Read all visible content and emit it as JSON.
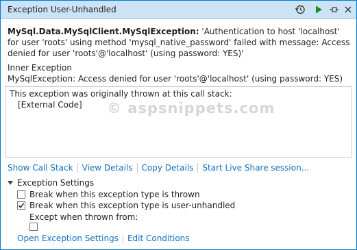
{
  "window": {
    "title": "Exception User-Unhandled"
  },
  "toolbar": {
    "history_icon": "history-icon",
    "continue_icon": "continue-play-icon",
    "pin_icon": "pin-icon",
    "close_icon": "close-icon"
  },
  "exception": {
    "type": "MySql.Data.MySqlClient.MySqlException:",
    "message": "'Authentication to host 'localhost' for user 'roots' using method 'mysql_native_password' failed with message: Access denied for user 'roots'@'localhost' (using password: YES)'",
    "inner_heading": "Inner Exception",
    "inner_message": "MySqlException: Access denied for user 'roots'@'localhost' (using password: YES)"
  },
  "call_stack": {
    "heading": "This exception was originally thrown at this call stack:",
    "lines": [
      "[External Code]"
    ],
    "watermark": "© aspsnippets.com"
  },
  "links": {
    "show_call_stack": "Show Call Stack",
    "view_details": "View Details",
    "copy_details": "Copy Details",
    "live_share": "Start Live Share session..."
  },
  "settings": {
    "heading": "Exception Settings",
    "break_thrown": {
      "label": "Break when this exception type is thrown",
      "checked": false
    },
    "break_unhandled": {
      "label": "Break when this exception type is user-unhandled",
      "checked": true
    },
    "except_label": "Except when thrown from:",
    "except_checked": false
  },
  "bottom_links": {
    "open_settings": "Open Exception Settings",
    "edit_conditions": "Edit Conditions"
  },
  "colors": {
    "accent": "#007acc",
    "titlebar": "#cce3f6",
    "link": "#0e70c0",
    "play_green": "#1e8a1e"
  }
}
